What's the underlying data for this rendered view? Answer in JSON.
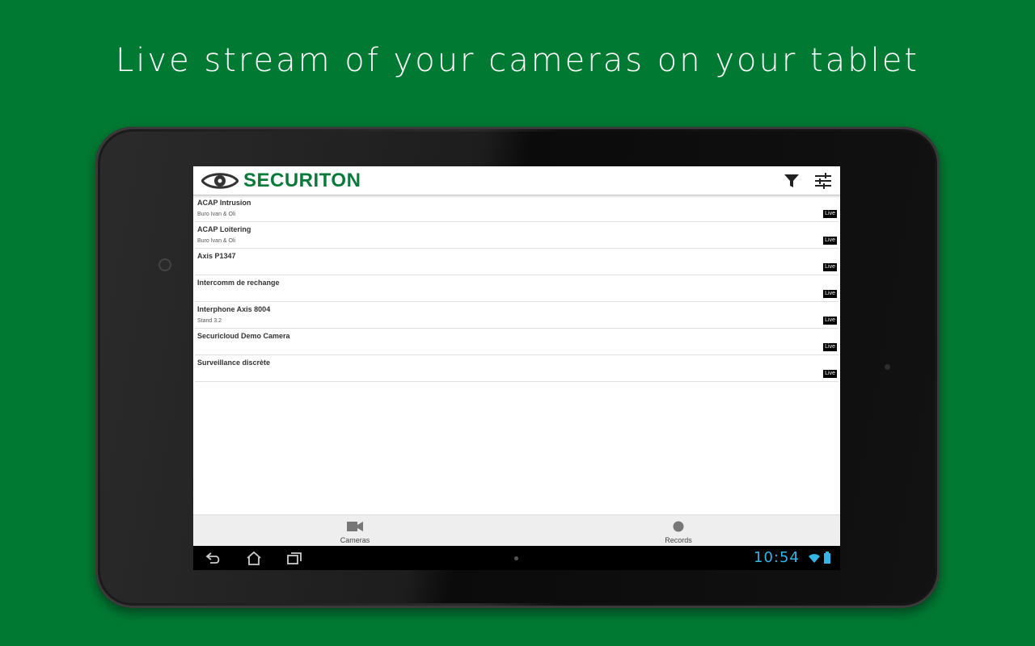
{
  "headline": "Live stream of your cameras on your tablet",
  "app": {
    "brand": "SECURITON",
    "accent_color": "#0a7a3a",
    "actions": [
      {
        "icon": "filter-icon"
      },
      {
        "icon": "settings-sliders-icon"
      }
    ]
  },
  "cameras": [
    {
      "name": "ACAP Intrusion",
      "location": "Buro Ivan & Oli",
      "badge": "Live"
    },
    {
      "name": "ACAP Loitering",
      "location": "Buro Ivan & Oli",
      "badge": "Live"
    },
    {
      "name": "Axis P1347",
      "location": "",
      "badge": "Live"
    },
    {
      "name": "Intercomm de rechange",
      "location": "",
      "badge": "Live"
    },
    {
      "name": "Interphone Axis 8004",
      "location": "Stand 3.2",
      "badge": "Live"
    },
    {
      "name": "Securicloud Demo Camera",
      "location": "",
      "badge": "Live"
    },
    {
      "name": "Surveillance discrète",
      "location": "",
      "badge": "Live"
    }
  ],
  "bottom_nav": [
    {
      "label": "Cameras",
      "icon": "video-camera-icon"
    },
    {
      "label": "Records",
      "icon": "record-dot-icon"
    }
  ],
  "system_bar": {
    "clock": "10:54",
    "clock_color": "#33b5e5"
  }
}
